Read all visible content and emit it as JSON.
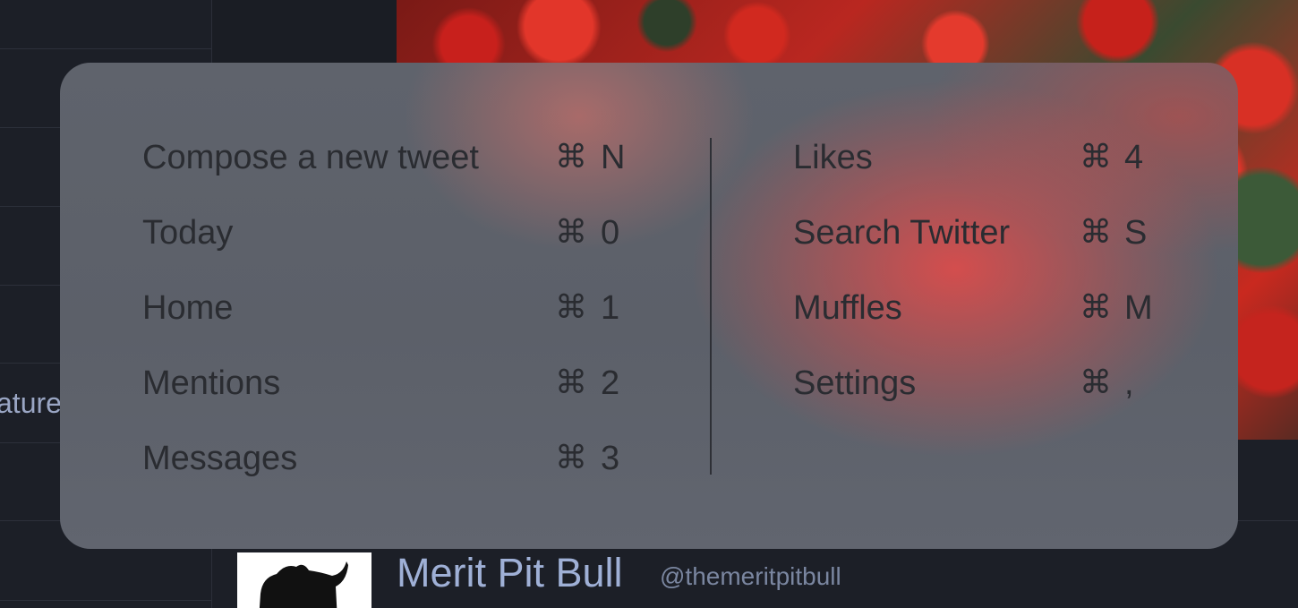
{
  "background": {
    "left_list_visible_label": "ature",
    "profile": {
      "name": "Merit Pit Bull",
      "handle": "@themeritpitbull"
    }
  },
  "shortcuts": {
    "left": [
      {
        "label": "Compose a new tweet",
        "symbol": "⌘",
        "key": "N"
      },
      {
        "label": "Today",
        "symbol": "⌘",
        "key": "0"
      },
      {
        "label": "Home",
        "symbol": "⌘",
        "key": "1"
      },
      {
        "label": "Mentions",
        "symbol": "⌘",
        "key": "2"
      },
      {
        "label": "Messages",
        "symbol": "⌘",
        "key": "3"
      }
    ],
    "right": [
      {
        "label": "Likes",
        "symbol": "⌘",
        "key": "4"
      },
      {
        "label": "Search Twitter",
        "symbol": "⌘",
        "key": "S"
      },
      {
        "label": "Muffles",
        "symbol": "⌘",
        "key": "M"
      },
      {
        "label": "Settings",
        "symbol": "⌘",
        "key": ","
      }
    ]
  },
  "colors": {
    "app_background": "#1b1e26",
    "overlay_base": "#5f636c",
    "overlay_text": "#2a2c31",
    "profile_name": "#9fb0d6",
    "accent_red": "#e84a48"
  }
}
